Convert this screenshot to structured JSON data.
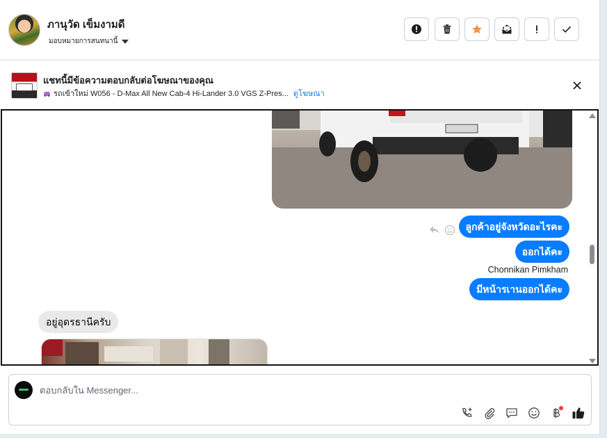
{
  "header": {
    "user_name": "ภานุวัด เข็มงามดี",
    "assign_label": "มอบหมายการสนทนานี้",
    "actions": [
      {
        "name": "report-button",
        "label": "!",
        "icon": "alert-circle-icon"
      },
      {
        "name": "delete-button",
        "label": "",
        "icon": "trash-icon"
      },
      {
        "name": "star-button",
        "label": "",
        "icon": "star-icon"
      },
      {
        "name": "mark-unread-button",
        "label": "",
        "icon": "envelope-icon"
      },
      {
        "name": "important-button",
        "label": "!",
        "icon": "exclamation-icon"
      },
      {
        "name": "done-button",
        "label": "",
        "icon": "check-icon"
      }
    ]
  },
  "ad": {
    "title": "แชทนี้มีข้อความตอบกลับต่อโฆษณาของคุณ",
    "subtitle": "รถเข้าใหม่ W056 - D-Max All New Cab-4 Hi-Lander 3.0 VGS Z-Pres...",
    "link_label": "ดูโฆษณา"
  },
  "messages": {
    "out_1": "ลูกค้าอยู่จังหวัดอะไรคะ",
    "out_2": "ออกได้คะ",
    "sender_name": "Chonnikan Pimkham",
    "out_3": "มีหน้ารเานออกได้คะ",
    "in_1": "อยู่อุดรธานีครับ"
  },
  "composer": {
    "placeholder": "ตอบกลับใน Messenger..."
  },
  "colors": {
    "accent": "#0a7cff",
    "star": "#f7923b",
    "alert_dot": "#fa383e"
  }
}
